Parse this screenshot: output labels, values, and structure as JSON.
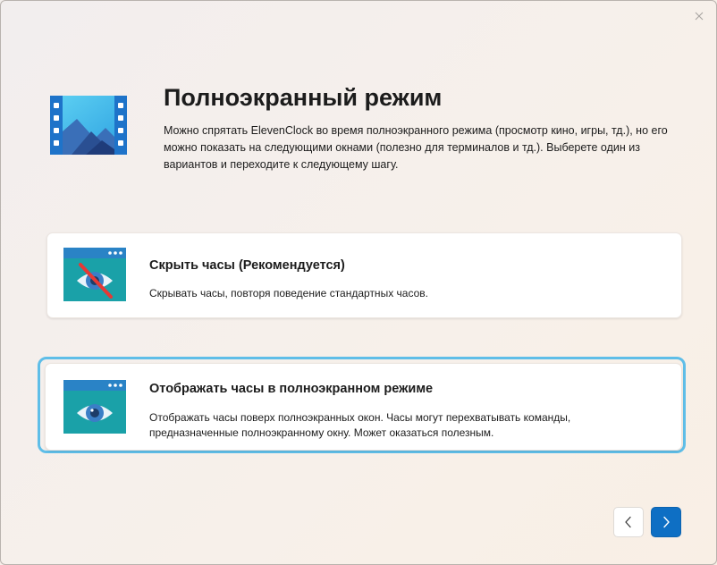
{
  "window": {
    "close_icon": "close-icon"
  },
  "header": {
    "icon": "film-landscape-icon",
    "title": "Полноэкранный режим",
    "description": "Можно спрятать ElevenClock во время полноэкранного режима (просмотр кино, игры, тд.), но его можно показать на следующими окнами (полезно для терминалов и тд.). Выберете один из вариантов и переходите к следующему шагу."
  },
  "options": [
    {
      "icon": "eye-crossed-window-icon",
      "title": "Скрыть часы (Рекомендуется)",
      "description": "Скрывать часы, повторя поведение стандартных часов."
    },
    {
      "icon": "eye-window-icon",
      "title": "Отображать часы в полноэкранном режиме",
      "description": "Отображать часы поверх полноэкранных окон. Часы могут перехватывать команды, предназначенные полноэкранному окну. Может оказаться полезным."
    }
  ],
  "nav": {
    "back_icon": "chevron-left-icon",
    "next_icon": "chevron-right-icon"
  },
  "colors": {
    "accent": "#0e6fc4",
    "focus_ring": "#5fbee8",
    "icon_teal": "#1aa1a8",
    "icon_blue": "#2a83c6"
  }
}
